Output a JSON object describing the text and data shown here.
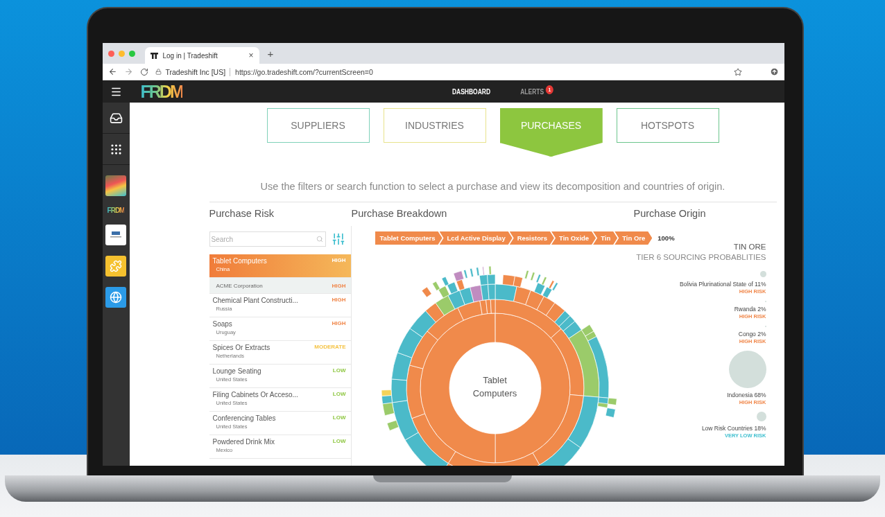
{
  "browser": {
    "tab_title": "Log in | Tradeshift",
    "tab_close": "×",
    "new_tab": "+",
    "site_identity": "Tradeshift Inc [US]",
    "url": "https://go.tradeshift.com/?currentScreen=0"
  },
  "app": {
    "logo": "FRDM",
    "nav": [
      {
        "label": "DASHBOARD",
        "selected": true
      },
      {
        "label": "ALERTS",
        "selected": false,
        "badge": "1"
      }
    ]
  },
  "sidebar": {
    "mini_logo": "FRDM"
  },
  "tabs": [
    {
      "label": "SUPPLIERS",
      "selected": false,
      "color": "#7fd1b9"
    },
    {
      "label": "INDUSTRIES",
      "selected": false,
      "color": "#e8e38c"
    },
    {
      "label": "PURCHASES",
      "selected": true,
      "color": "#8dc63f"
    },
    {
      "label": "HOTSPOTS",
      "selected": false,
      "color": "#6cc58c"
    }
  ],
  "instructions": "Use the filters or search function to select a purchase and view its decomposition and countries of origin.",
  "purchase_risk": {
    "title": "Purchase Risk",
    "search": {
      "placeholder": "Search"
    },
    "items": [
      {
        "name": "Tablet Computers",
        "country": "China",
        "risk": "HIGH",
        "kind": "high",
        "selected": true,
        "expanded": true,
        "suppliers": [
          {
            "name": "ACME Corporation",
            "risk": "HIGH",
            "kind": "high"
          }
        ]
      },
      {
        "name": "Chemical Plant Constructi...",
        "country": "Russia",
        "risk": "HIGH",
        "kind": "high",
        "selected": false
      },
      {
        "name": "Soaps",
        "country": "Uruguay",
        "risk": "HIGH",
        "kind": "high",
        "selected": false
      },
      {
        "name": "Spices Or Extracts",
        "country": "Netherlands",
        "risk": "MODERATE",
        "kind": "moderate",
        "selected": false
      },
      {
        "name": "Lounge Seating",
        "country": "United States",
        "risk": "LOW",
        "kind": "low",
        "selected": false
      },
      {
        "name": "Filing Cabinets Or Acceso...",
        "country": "United States",
        "risk": "LOW",
        "kind": "low",
        "selected": false
      },
      {
        "name": "Conferencing Tables",
        "country": "United States",
        "risk": "LOW",
        "kind": "low",
        "selected": false
      },
      {
        "name": "Powdered Drink Mix",
        "country": "Mexico",
        "risk": "LOW",
        "kind": "low",
        "selected": false
      }
    ]
  },
  "purchase_breakdown": {
    "title": "Purchase Breakdown",
    "path": [
      "Tablet Computers",
      "Lcd Active Display",
      "Resistors",
      "Tin Oxide",
      "Tin",
      "Tin Ore"
    ],
    "share": "100%",
    "center_label": "Tablet Computers"
  },
  "purchase_origin": {
    "title": "Purchase Origin",
    "material": "TIN ORE",
    "subtitle": "TIER 6 SOURCING PROBABLITIES",
    "countries": [
      {
        "label": "Bolivia Plurinational State of 11%",
        "risk": "HIGH RISK",
        "kind": "high"
      },
      {
        "label": "Rwanda 2%",
        "risk": "HIGH RISK",
        "kind": "high"
      },
      {
        "label": "Congo 2%",
        "risk": "HIGH RISK",
        "kind": "high"
      },
      {
        "label": "Indonesia 68%",
        "risk": "HIGH RISK",
        "kind": "high"
      },
      {
        "label": "Low Risk Countries 18%",
        "risk": "VERY LOW RISK",
        "kind": "very_low"
      }
    ]
  }
}
